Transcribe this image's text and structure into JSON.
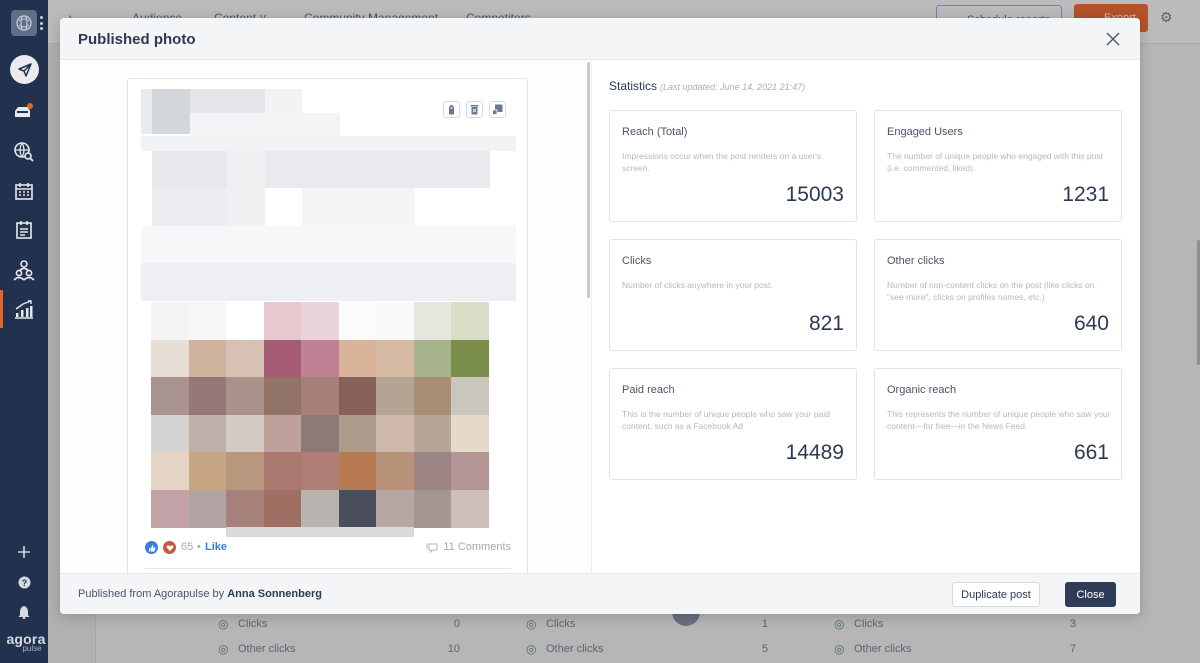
{
  "sidebar": {
    "brand_top": "agora",
    "brand_bottom": "pulse",
    "items": [
      {
        "name": "compose",
        "icon": "paper-plane-icon"
      },
      {
        "name": "inbox",
        "icon": "inbox-icon",
        "badge": true
      },
      {
        "name": "listening",
        "icon": "globe-search-icon"
      },
      {
        "name": "calendar",
        "icon": "calendar-icon"
      },
      {
        "name": "content-list",
        "icon": "notepad-icon"
      },
      {
        "name": "users",
        "icon": "users-icon"
      },
      {
        "name": "reports",
        "icon": "chart-icon",
        "active": true
      }
    ],
    "bottom_items": [
      {
        "name": "add",
        "icon": "plus-icon"
      },
      {
        "name": "help",
        "icon": "help-icon"
      },
      {
        "name": "notifications",
        "icon": "bell-icon"
      }
    ]
  },
  "background": {
    "tabs": [
      "Audience",
      "Content ˅",
      "Community Management",
      "Competitors"
    ],
    "schedule_reports": "Schedule reports",
    "export": "Export",
    "table": [
      {
        "label": "Clicks",
        "value": "0"
      },
      {
        "label": "Other clicks",
        "value": "10"
      },
      {
        "label": "Clicks",
        "value": "1"
      },
      {
        "label": "Other clicks",
        "value": "5"
      },
      {
        "label": "Clicks",
        "value": "3"
      },
      {
        "label": "Other clicks",
        "value": "7"
      }
    ]
  },
  "modal": {
    "title": "Published photo",
    "post": {
      "reaction_count": "65",
      "separator": "•",
      "like_label": "Like",
      "comments_label": "11 Comments",
      "actions": [
        "tag-icon",
        "trash-icon",
        "expand-icon"
      ],
      "image_palette": [
        [
          "#f3f4f6",
          "#f6f7f8",
          "#ffffff",
          "#e7c8cf",
          "#ead3da",
          "#fbfbfb",
          "#f8f9f9",
          "#e6e6dc",
          "#d7ddc6"
        ],
        [
          "#e6ddd5",
          "#cfb39c",
          "#d7c0b4",
          "#a75c75",
          "#bf8193",
          "#d9b49b",
          "#d5b9a3",
          "#a6b38c",
          "#7b8e4b"
        ],
        [
          "#a8938f",
          "#957977",
          "#a9928c",
          "#927367",
          "#a57f79",
          "#86615a",
          "#b4a493",
          "#a98d74",
          "#c9c7bd"
        ],
        [
          "#d6d3d4",
          "#bfb0aa",
          "#d5c9c3",
          "#c0a09b",
          "#8c7a75",
          "#ae9a8b",
          "#cdb8ab",
          "#b6a699",
          "#e5d9c7"
        ],
        [
          "#e3d4c6",
          "#c5a582",
          "#b7987e",
          "#a97970",
          "#b07d77",
          "#b87a52",
          "#b8937a",
          "#9c8584",
          "#b29594"
        ],
        [
          "#c3a3a7",
          "#b3a3a3",
          "#a6827a",
          "#9f6f64",
          "#b9b3b2",
          "#4a4e5c",
          "#b6a7a5",
          "#a49690",
          "#cdbdbb"
        ]
      ],
      "header_blocks": true
    },
    "stats": {
      "title": "Statistics",
      "last_updated": "(Last updated: June 14, 2021 21:47)",
      "cards": [
        {
          "label": "Reach (Total)",
          "description": "Impressions occur when the post renders on a user's screen.",
          "value": "15003"
        },
        {
          "label": "Engaged Users",
          "description": "The number of unique people who engaged with this post (i.e. commented, liked).",
          "value": "1231"
        },
        {
          "label": "Clicks",
          "description": "Number of clicks anywhere in your post.",
          "value": "821"
        },
        {
          "label": "Other clicks",
          "description": "Number of non-content clicks on the post (like clicks on \"see more\", clicks on profiles names, etc.)",
          "value": "640"
        },
        {
          "label": "Paid reach",
          "description": "This is the number of unique people who saw your paid content, such as a Facebook Ad",
          "value": "14489"
        },
        {
          "label": "Organic reach",
          "description": "This represents the number of unique people who saw your content—for free—in the News Feed.",
          "value": "661"
        }
      ]
    },
    "footer": {
      "published_prefix": "Published from Agorapulse by",
      "author": "Anna Sonnenberg",
      "duplicate_label": "Duplicate post",
      "close_label": "Close"
    }
  }
}
